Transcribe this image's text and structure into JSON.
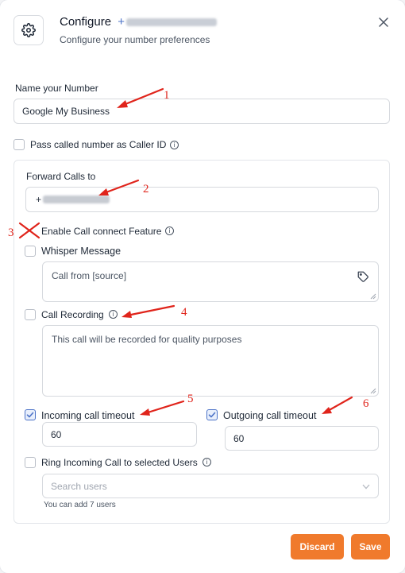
{
  "header": {
    "title": "Configure",
    "phone_prefix": "+",
    "subtitle": "Configure your number preferences"
  },
  "name_section": {
    "label": "Name your Number",
    "value": "Google My Business"
  },
  "pass_called": {
    "label": "Pass called number as Caller ID",
    "checked": false
  },
  "forward": {
    "label": "Forward Calls to",
    "value_prefix": "+"
  },
  "call_connect": {
    "label": "Enable Call connect Feature"
  },
  "whisper": {
    "label": "Whisper Message",
    "checked": false,
    "text": "Call from [source]"
  },
  "recording": {
    "label": "Call Recording",
    "checked": false,
    "text": "This call will be recorded for quality purposes"
  },
  "incoming": {
    "label": "Incoming call timeout",
    "checked": true,
    "value": "60"
  },
  "outgoing": {
    "label": "Outgoing call timeout",
    "checked": true,
    "value": "60"
  },
  "ring": {
    "label": "Ring Incoming Call to selected Users",
    "checked": false,
    "placeholder": "Search users",
    "hint": "You can add 7 users"
  },
  "footer": {
    "discard_label": "Discard",
    "save_label": "Save",
    "accent_color": "#f07a2c"
  },
  "annotations": {
    "n1": "1",
    "n2": "2",
    "n3": "3",
    "n4": "4",
    "n5": "5",
    "n6": "6",
    "color": "#e0241b"
  }
}
